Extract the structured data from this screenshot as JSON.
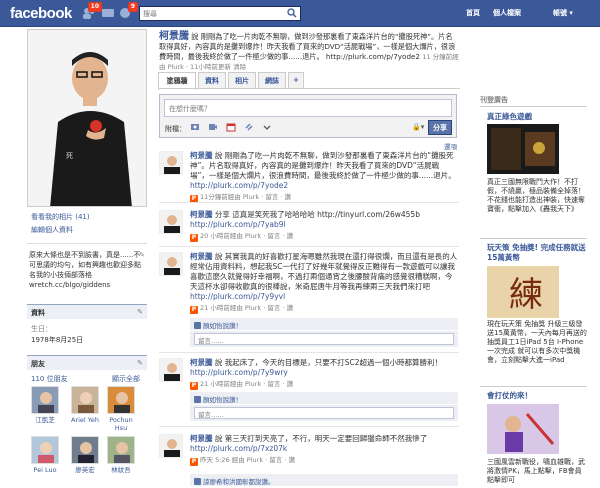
{
  "topbar": {
    "logo": "facebook",
    "notif_requests": "10",
    "notif_messages": "9",
    "search_placeholder": "搜尋",
    "nav_home": "首頁",
    "nav_profile": "個人檔案",
    "nav_account": "帳號 ▾"
  },
  "left": {
    "view_photos": "看看我的相片 (41)",
    "edit_profile": "編輯個人資料",
    "bio": "原來大條也是不到臉書，真是......不可思議的均勻，如有興趣也歡迎多點名我的小技倆部落格 wretch.cc/blgo/giddens",
    "info_title": "資料",
    "birthday_label": "生日：",
    "birthday_value": "1978年8月25日",
    "friends_title": "朋友",
    "friends_count": "110 位朋友",
    "friends_see_all": "顯示全部",
    "friends": [
      "江凱芝",
      "Ariel Yeh",
      "Pochun Hsu",
      "Pei Luo",
      "廖英宏",
      "林紋吾"
    ]
  },
  "status": {
    "name": "柯景騰",
    "text": "說 剛剛為了吃一片肉乾不無聊，做到沙發那裏看了東森洋片台的“攤股死神”。片名取得真好，內容真的是攤到爆炸！昨天我看了買來的DVD“活屍戰場”，一樣是個大爛片，很浪費時間，最後我終於做了一件極少做的事......退片。 http://plurk.com/p/7yode2",
    "time": "11 分鐘前經由 Plurk · 11小時前更新",
    "clear": "清除"
  },
  "tabs": [
    "塗鴉牆",
    "資料",
    "相片",
    "網誌",
    "+"
  ],
  "composer": {
    "placeholder": "在想什麼嗎？",
    "attach_label": "附檔：",
    "share": "分享",
    "options": "選項"
  },
  "stories": [
    {
      "name": "柯景騰",
      "text": "說 剛剛為了吃一片肉乾不無聊，做到沙發那裏看了東森洋片台的“攤股死神”。片名取得真好，內容真的是攤到爆炸！昨天我看了買來的DVD“活屍戰場”，一樣是個大爛片，很浪費時間，最後我終於做了一件極少做的事......退片。",
      "link": "http://plurk.com/p/7yode2",
      "meta": "11分鐘前經由 Plurk · 留言 · 讚"
    },
    {
      "name": "柯景騰",
      "text": "分享 這真是笑死我了哈哈哈哈 http://tinyurl.com/26w455b",
      "link": "http://plurk.com/p/7yab9l",
      "meta": "20 小時前經由 Plurk · 留言 · 讚"
    },
    {
      "name": "柯景騰",
      "text": "說 其實我真的好喜歡打星海嗯雖然我現在還打得很爛，而且還有是長的人經常佔用資料料，想起我SC一代打了好幾年就覺得反正難得有一款遊戲可以讓我喜歡這麼久就覺得好幸福啊，不過打兩個通宵之後腰酸背痛的感覺很糟糕啊，今天這杯水卻得收歡真的很棒說，米奇屁唐牛月等我再練兩三天我們來打吧",
      "link": "http://plurk.com/p/7y9yvl",
      "meta": "21 小時前經由 Plurk · 留言 · 讚"
    },
    {
      "name": "柯景騰",
      "text": "說 我起床了，今天的目標是，只要不打SC2超過一個小時都算勝利！",
      "link": "http://plurk.com/p/7y9wry",
      "meta": "21 小時前經由 Plurk · 留言 · 讚"
    },
    {
      "name": "柯景騰",
      "text": "說 第三天打到天亮了，不行，明天一定要回歸獵命師不然我慘了",
      "link": "http://plurk.com/p/7xz07k",
      "meta": "昨天 5:26 經由 Plurk · 留言 · 讚"
    }
  ],
  "likes": {
    "s2": "顏如怡說讚！",
    "s4": "顏如怡說讚！",
    "s5": "諒廖希和洪國彰都說讚。"
  },
  "comment_placeholder": "留言……",
  "ads": {
    "title": "刊登廣告",
    "ad1_title": "真正綠色遊戲",
    "ad1_text": "真正三國無限戰鬥大作！不打假，不繞贏，極品裝備全掉落！不花錢也能打造出神裝，快速奪寶衝，點擊加入《轟我天下》",
    "ad2_title": "玩天策 免抽獎! 完成任務就送15萬黃幣",
    "ad2_text": "現在玩天策 免抽獎 升級三級發送15萬黃幣，一天內每月再送的抽獎員工1日iPad 5台 I-Phone 一次完成 就可以有多次中獎機會，立刻點擊大進一iPad",
    "ad3_title": "會打仗的來！",
    "ad3_text": "三國風雲新戰役，嘯血雄戰，武將激情PK，馬上點擊，FB會員點擊即可"
  },
  "colors": {
    "brand": "#3b5998",
    "accent_orange": "#ff5700"
  }
}
